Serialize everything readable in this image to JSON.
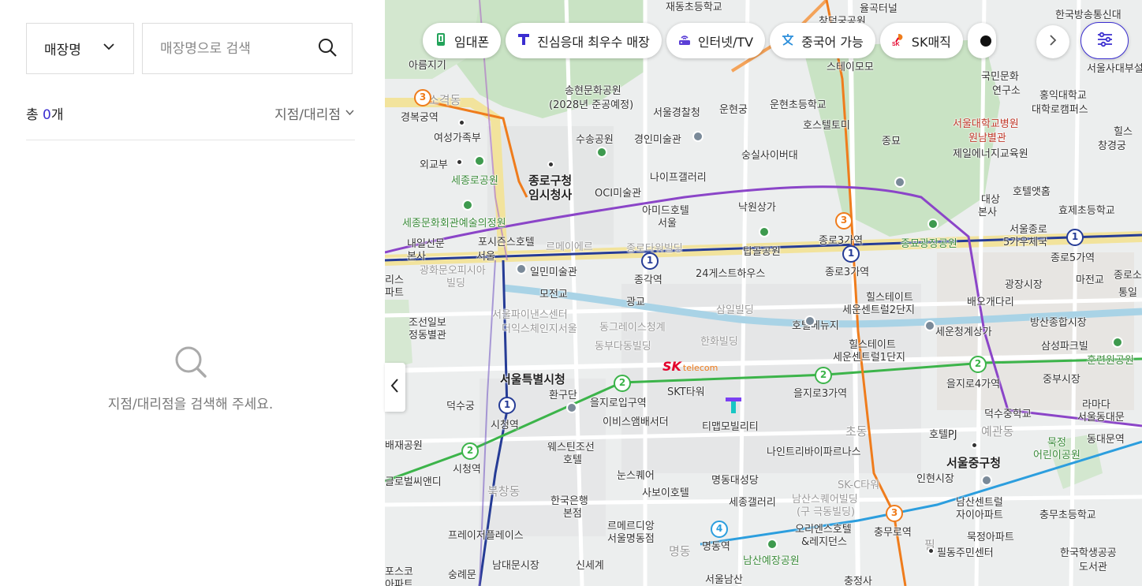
{
  "panel": {
    "select_label": "매장명",
    "search_placeholder": "매장명으로 검색",
    "count_prefix": "총 ",
    "count_value": "0",
    "count_suffix": "개",
    "filter_label": "지점/대리점",
    "empty_message": "지점/대리점을 검색해 주세요."
  },
  "chips": [
    {
      "label": "임대폰",
      "icon": "phone-icon"
    },
    {
      "label": "진심응대 최우수 매장",
      "icon": "t-logo-icon"
    },
    {
      "label": "인터넷/TV",
      "icon": "router-icon"
    },
    {
      "label": "중국어 가능",
      "icon": "translate-icon"
    },
    {
      "label": "SK매직",
      "icon": "sk-magic-icon"
    }
  ],
  "colors": {
    "accent": "#3b2ed0",
    "line1": "#263c96",
    "line2": "#3cb44a",
    "line3": "#ef7c1c",
    "line4": "#2c9ede",
    "line5": "#8b45c8",
    "park": "#c9e3c4"
  },
  "map": {
    "labels": {
      "l1": "재동초등학교",
      "l2": "창덕궁공원",
      "l3": "율곡터널",
      "l4": "한국방송통신대",
      "l5": "아름지기",
      "l6": "소격동",
      "l7": "송현문화공원",
      "l8": "(2028년 준공예정)",
      "l9": "서울경찰청",
      "l10": "운현궁",
      "l11": "운현초등학교",
      "l12": "스테이모모",
      "l13": "국민문화",
      "l14": "연구소",
      "l15": "홍익대학교",
      "l16": "대학로캠퍼스",
      "l17": "서울사대부설",
      "l18": "경복궁역",
      "l19": "여성가족부",
      "l20": "수송공원",
      "l21": "경인미술관",
      "l22": "숭실사이버대",
      "l23": "호스텔토미",
      "l24": "종묘",
      "l25": "서울대학교병원",
      "l26": "원남별관",
      "l27": "제일에너지교육원",
      "l28": "힐스",
      "l29": "창경궁",
      "l30": "외교부",
      "l31": "세종로공원",
      "l32": "종로구청",
      "l33": "임시청사",
      "l34": "나이프갤러리",
      "l35": "OCI미술관",
      "l36": "아미드호텔",
      "l37": "서울",
      "l38": "낙원상가",
      "l39": "호텔앳홈",
      "l40": "대상",
      "l41": "본사",
      "l42": "효제초등학교",
      "l43": "세종문화회관예술의정원",
      "l44": "포시즌스호텔",
      "l45": "서울",
      "l46": "르메이에르",
      "l47": "종로타워빌딩",
      "l48": "탑골공원",
      "l49": "종로3가역",
      "l50": "종묘광장공원",
      "l51": "서울종로",
      "l52": "5가우체국",
      "l53": "내일신문",
      "l54": "본사",
      "l55": "광화문오피시아",
      "l56": "빌딩",
      "l57": "일민미술관",
      "l58": "종각역",
      "l59": "24게스트하우스",
      "l60": "종로3가역",
      "l61": "종로5가역",
      "l62": "리스",
      "l63": "파트",
      "l64": "모전교",
      "l65": "광교",
      "l66": "삼일빌딩",
      "l67": "힐스테이트",
      "l68": "세운센트럴2단지",
      "l69": "배오개다리",
      "l70": "광장시장",
      "l71": "마전교",
      "l72": "종로소",
      "l73": "통일",
      "l74": "조선일보",
      "l75": "정동별관",
      "l76": "서울파이낸스센터",
      "l77": "더익스체인지서울",
      "l78": "동그레이스청계",
      "l79": "동부다동빌딩",
      "l80": "호텔베뉴지",
      "l81": "세운청계상가",
      "l82": "방산종합시장",
      "l83": "한화빌딩",
      "l84": "힐스테이트",
      "l85": "세운센트럴1단지",
      "l86": "삼성파크빌",
      "l87": "훈련원공원",
      "l88": "서울특별시청",
      "l89": "SKT타워",
      "l90": "을지로3가역",
      "l91": "을지로4가역",
      "l92": "중부시장",
      "l93": "덕수궁",
      "l94": "환구단",
      "l95": "을지로입구역",
      "l96": "이비스앰배서더",
      "l97": "티맵모빌리티",
      "l98": "덕수중학교",
      "l99": "라마다",
      "l100": "서울동대문",
      "l101": "시청역",
      "l102": "배재공원",
      "l103": "웨스틴조선",
      "l104": "호텔",
      "l105": "나인트리바이파르나스",
      "l106": "초동",
      "l107": "호텔PJ",
      "l108": "예관동",
      "l109": "서울중구청",
      "l110": "묵정",
      "l111": "어린이공원",
      "l112": "동대문역",
      "l113": "시청역",
      "l114": "눈스퀘어",
      "l115": "명동대성당",
      "l116": "인현시장",
      "l117": "글로벌씨앤디",
      "l118": "북창동",
      "l119": "사보이호텔",
      "l120": "SK-C타워",
      "l121": "한국은행",
      "l122": "본점",
      "l123": "세종갤러리",
      "l124": "남산스퀘어빌딩",
      "l125": "(구 극동빌딩)",
      "l126": "남산센트럴",
      "l127": "자이아파트",
      "l128": "충무초등학교",
      "l129": "르메르디앙",
      "l130": "서울명동점",
      "l131": "오리엔스호텔",
      "l132": "&레지던스",
      "l133": "충무로역",
      "l134": "묵정아파트",
      "l135": "프레이저플레이스",
      "l136": "명동역",
      "l137": "필동주민센터",
      "l138": "한국학생공공",
      "l139": "도서관",
      "l140": "포스코",
      "l141": "아파트",
      "l142": "숭례문",
      "l143": "남대문시장",
      "l144": "신세계",
      "l145": "남산예장공원",
      "l146": "서울남산",
      "l147": "충정사",
      "l148": "명동",
      "l149": "필"
    },
    "stations": [
      {
        "line": "3",
        "name": "경복궁"
      },
      {
        "line": "3",
        "name": "종로3가"
      },
      {
        "line": "1",
        "name": "종각"
      },
      {
        "line": "1",
        "name": "종로3가"
      },
      {
        "line": "1",
        "name": "종로5가"
      },
      {
        "line": "1",
        "name": "시청"
      },
      {
        "line": "2",
        "name": "을지로입구"
      },
      {
        "line": "2",
        "name": "을지로3가"
      },
      {
        "line": "2",
        "name": "을지로4가"
      },
      {
        "line": "2",
        "name": "시청"
      },
      {
        "line": "3",
        "name": "충무로"
      },
      {
        "line": "4",
        "name": "명동"
      }
    ],
    "sk_logo_text": "SK",
    "sk_logo_sub": "telecom"
  }
}
